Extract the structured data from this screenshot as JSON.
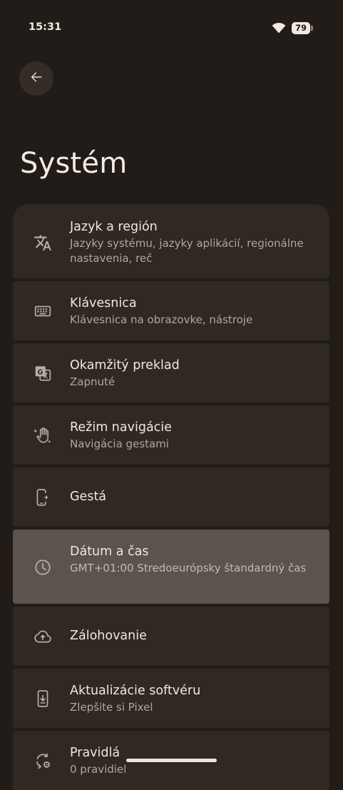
{
  "status_bar": {
    "time": "15:31",
    "battery_level": "79"
  },
  "header": {
    "back_icon": "arrow-back-icon",
    "title": "Systém"
  },
  "items": [
    {
      "icon": "translate-icon",
      "title": "Jazyk a región",
      "subtitle": "Jazyky systému, jazyky aplikácií, regionálne nastavenia, reč"
    },
    {
      "icon": "keyboard-icon",
      "title": "Klávesnica",
      "subtitle": "Klávesnica na obrazovke, nástroje"
    },
    {
      "icon": "instant-translate-icon",
      "title": "Okamžitý preklad",
      "subtitle": "Zapnuté"
    },
    {
      "icon": "gesture-hand-icon",
      "title": "Režim navigácie",
      "subtitle": "Navigácia gestami"
    },
    {
      "icon": "phone-gesture-icon",
      "title": "Gestá",
      "subtitle": ""
    },
    {
      "icon": "clock-icon",
      "title": "Dátum a čas",
      "subtitle": "GMT+01:00 Stredoeurópsky štandardný čas"
    },
    {
      "icon": "cloud-upload-icon",
      "title": "Zálohovanie",
      "subtitle": ""
    },
    {
      "icon": "system-update-icon",
      "title": "Aktualizácie softvéru",
      "subtitle": "Zlepšite si Pixel"
    },
    {
      "icon": "rules-icon",
      "title": "Pravidlá",
      "subtitle": "0 pravidiel"
    }
  ],
  "colors": {
    "background": "#211c18",
    "card": "#2f2823",
    "card_highlighted": "#5c534d",
    "text_primary": "#f3e7de",
    "text_secondary": "#b3a69c"
  }
}
